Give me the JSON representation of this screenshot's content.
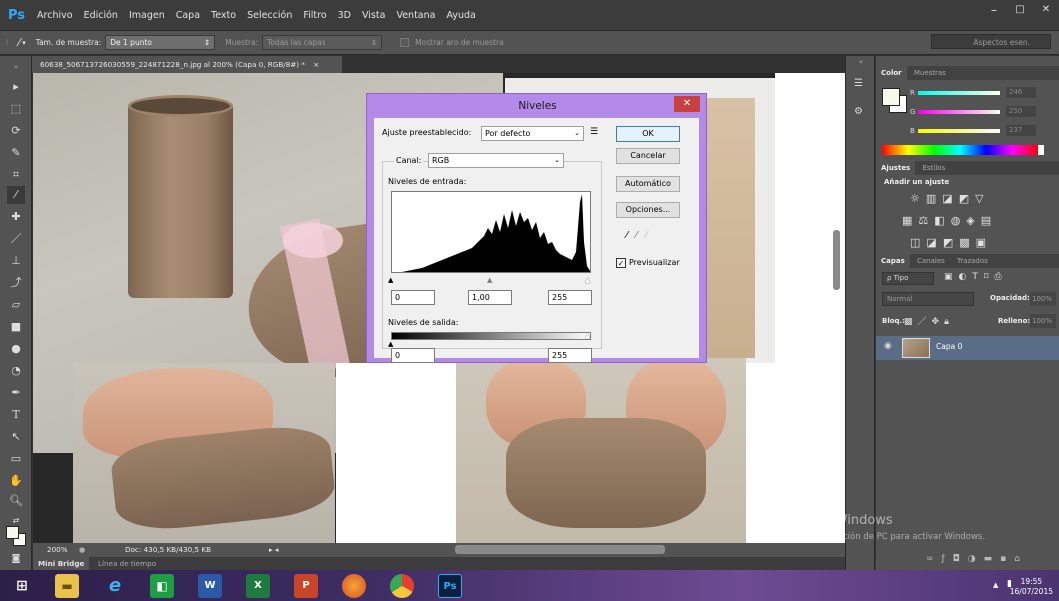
{
  "app": {
    "logo": "Ps",
    "menu": [
      "Archivo",
      "Edición",
      "Imagen",
      "Capa",
      "Texto",
      "Selección",
      "Filtro",
      "3D",
      "Vista",
      "Ventana",
      "Ayuda"
    ],
    "window_controls": [
      "–",
      "□",
      "✕"
    ]
  },
  "options_bar": {
    "size_label": "Tam. de muestra:",
    "size_value": "De 1 punto",
    "sample_label": "Muestra:",
    "sample_value": "Todas las capas",
    "ring_label": "Mostrar aro de muestra",
    "workspace": "Aspectos esen."
  },
  "document": {
    "tab_title": "60638_506713726030559_224871228_n.jpg al 200% (Capa 0, RGB/8#) *",
    "tab_close": "×",
    "zoom": "200%",
    "doc_info": "Doc: 430,5 KB/430,5 KB"
  },
  "bottom_tabs": [
    "Mini Bridge",
    "Línea de tiempo"
  ],
  "color_panel": {
    "tabs": [
      "Color",
      "Muestras"
    ],
    "channels": [
      {
        "label": "R",
        "value": "246"
      },
      {
        "label": "G",
        "value": "250"
      },
      {
        "label": "B",
        "value": "237"
      }
    ],
    "swatch_color": "#f6faed"
  },
  "adjust_panel": {
    "tabs": [
      "Ajustes",
      "Estilos"
    ],
    "heading": "Añadir un ajuste"
  },
  "layers_panel": {
    "tabs": [
      "Capas",
      "Canales",
      "Trazados"
    ],
    "filter": "ρ Tipo",
    "blend_mode": "Normal",
    "opacity_label": "Opacidad:",
    "opacity_value": "100%",
    "lock_label": "Bloq.:",
    "fill_label": "Relleno:",
    "fill_value": "100%",
    "layer_name": "Capa 0"
  },
  "levels_dialog": {
    "title": "Niveles",
    "close": "✕",
    "preset_label": "Ajuste preestablecido:",
    "preset_value": "Por defecto",
    "channel_label": "Canal:",
    "channel_value": "RGB",
    "input_label": "Niveles de entrada:",
    "input_black": "0",
    "input_gamma": "1,00",
    "input_white": "255",
    "output_label": "Niveles de salida:",
    "output_black": "0",
    "output_white": "255",
    "buttons": {
      "ok": "OK",
      "cancel": "Cancelar",
      "auto": "Automático",
      "options": "Opciones..."
    },
    "preview_label": "Previsualizar",
    "preview_checked": true
  },
  "watermark": {
    "title": "Activar Windows",
    "subtitle": "Ir a Configuración de PC para activar Windows."
  },
  "taskbar": {
    "time": "19:55",
    "date": "16/07/2015",
    "apps": [
      "windows",
      "explorer",
      "ie",
      "store",
      "word",
      "excel",
      "powerpoint",
      "firefox",
      "chrome",
      "photoshop"
    ]
  }
}
